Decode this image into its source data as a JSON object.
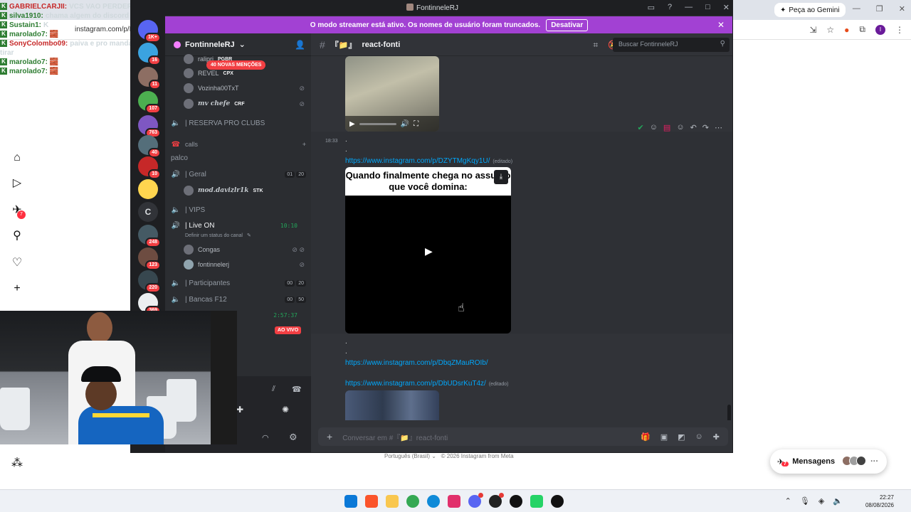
{
  "stream_chat": [
    {
      "user": "GABRIELCARJII:",
      "message": "VCS VAO PERDER FEIO",
      "highlight": true
    },
    {
      "user": "silva1910:",
      "message": "chama algem do discord",
      "highlight": false
    },
    {
      "user": "Sustain1:",
      "message": "K",
      "highlight": false
    },
    {
      "user": "marolado7:",
      "message": "🧱",
      "highlight": false
    },
    {
      "user": "SonyColombo09:",
      "message": "paiva e pro manda",
      "highlight": true
    },
    {
      "user": "",
      "message": "tirar",
      "highlight": false
    },
    {
      "user": "marolado7:",
      "message": "🧱",
      "highlight": false
    },
    {
      "user": "marolado7:",
      "message": "🧱",
      "highlight": false
    }
  ],
  "browser": {
    "url": "instagram.com/p/D",
    "gemini_button": "Peça ao Gemini",
    "profile_initial": "I",
    "footer_language": "Português (Brasil)",
    "footer_copyright": "© 2026 Instagram from Meta",
    "messages_label": "Mensagens",
    "messages_badge": "7",
    "notifications_badge": "7"
  },
  "discord": {
    "window_title": "FontinneleRJ",
    "streamer_banner": "O modo streamer está ativo. Os nomes de usuário foram truncados.",
    "streamer_disable": "Desativar",
    "guild_name": "FontinneleRJ",
    "mentions_pill": "40 NOVAS MENÇÕES",
    "servers": [
      {
        "badge": "1K+"
      },
      {
        "badge": "16"
      },
      {
        "badge": "11"
      },
      {
        "badge": "107"
      },
      {
        "badge": "763"
      },
      {
        "badge": "40"
      },
      {
        "badge": "10"
      },
      {
        "badge": ""
      },
      {
        "badge": "",
        "letter": "C"
      },
      {
        "badge": "248"
      },
      {
        "badge": "123"
      },
      {
        "badge": "220"
      },
      {
        "badge": "369"
      }
    ],
    "channels": {
      "user_ralipri": "ralipri",
      "tag_pgbr": "PGBR",
      "user_revel": "REVEL",
      "tag_cpx": "CPX",
      "user_vozinha": "Vozinha00TxT",
      "user_mvchefe": "mv chefe",
      "tag_crf": "CRF",
      "reserva": "| RESERVA PRO CLUBS",
      "calls_category": "calls",
      "palco": "palco",
      "geral": "| Geral",
      "geral_count_a": "01",
      "geral_count_b": "20",
      "user_davizl": "mod.davizlr1k",
      "tag_stk": "STK",
      "vips": "| VIPS",
      "live_on": "| Live ON",
      "live_on_timer": "10:10",
      "live_on_status": "Definir um status do canal",
      "user_congas": "Congas",
      "user_fontinnelerj": "fontinnelerj",
      "participantes": "| Participantes",
      "part_count_a": "00",
      "part_count_b": "20",
      "bancas": "| Bancas F12",
      "bancas_count_a": "00",
      "bancas_count_b": "50",
      "other_timer": "2:57:37",
      "ao_vivo": "AO VIVO"
    },
    "channel_name": "react-fonti",
    "channel_prefix": "『📁』",
    "search_placeholder": "Buscar FontinneleRJ",
    "messages": {
      "time": "18:33",
      "dot": ".",
      "link1": "https://www.instagram.com/p/DZYTMgKqy1U/",
      "edited": "(editado)",
      "video_caption": "Quando finalmente chega no assunto que você domina:",
      "link2": "https://www.instagram.com/p/DbqZMauROIb/",
      "link3": "https://www.instagram.com/p/DbUDsrKuT4z/"
    },
    "input_placeholder": "Conversar em #『📁』react-fonti"
  },
  "taskbar": {
    "time": "22:27",
    "date": "08/08/2026"
  },
  "colors": {
    "discord_bg": "#313338",
    "streamer_banner": "#a241d3",
    "link": "#00a8fc",
    "badge_red": "#f23f43",
    "voice_green": "#23a55a"
  }
}
